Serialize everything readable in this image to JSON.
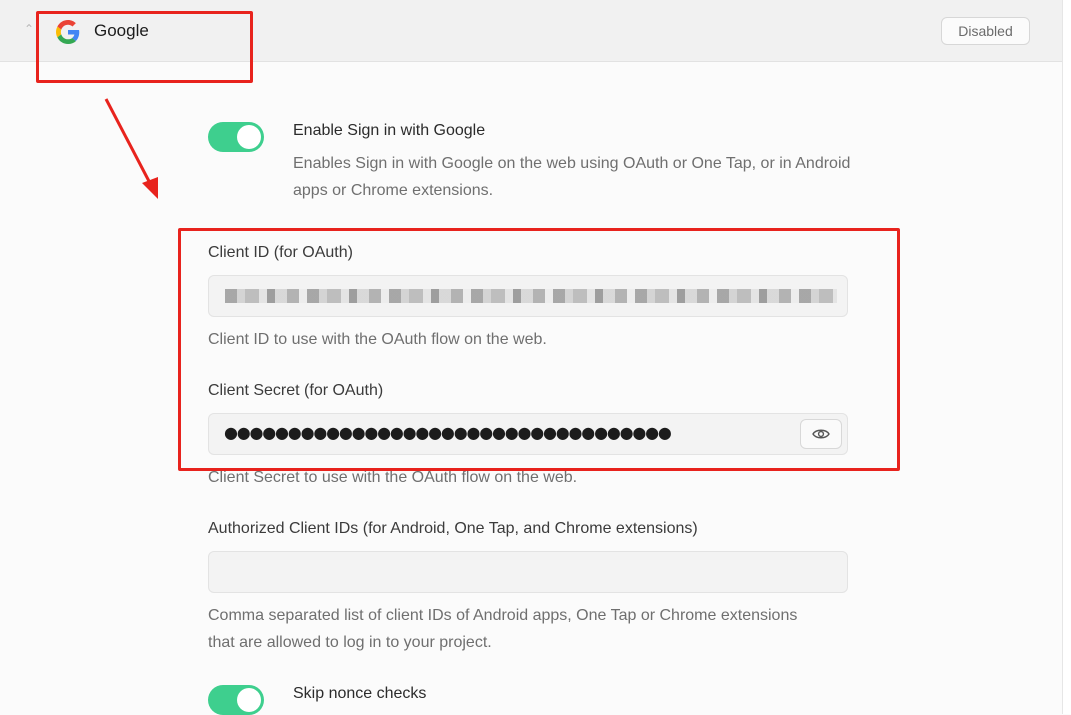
{
  "provider": {
    "name": "Google",
    "status": "Disabled",
    "icon": "google-logo"
  },
  "enable_option": {
    "label": "Enable Sign in with Google",
    "description": "Enables Sign in with Google on the web using OAuth or One Tap, or in Android apps or Chrome extensions.",
    "enabled": true
  },
  "client_id": {
    "label": "Client ID (for OAuth)",
    "value": "(redacted / pixelated)",
    "help": "Client ID to use with the OAuth flow on the web."
  },
  "client_secret": {
    "label": "Client Secret (for OAuth)",
    "masked_value": "●●●●●●●●●●●●●●●●●●●●●●●●●●●●●●●●●●●",
    "help": "Client Secret to use with the OAuth flow on the web.",
    "reveal_icon": "eye-icon"
  },
  "authorized_client_ids": {
    "label": "Authorized Client IDs (for Android, One Tap, and Chrome extensions)",
    "value": "",
    "help": "Comma separated list of client IDs of Android apps, One Tap or Chrome extensions that are allowed to log in to your project."
  },
  "skip_nonce": {
    "label": "Skip nonce checks",
    "enabled": true
  },
  "colors": {
    "accent": "#3ecf8e",
    "annotation": "#e8231d"
  }
}
